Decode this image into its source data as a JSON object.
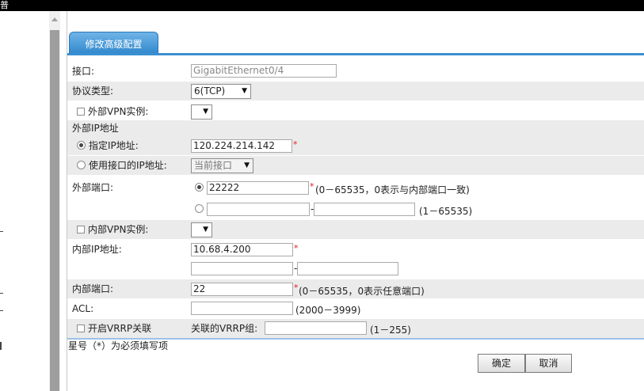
{
  "window": {
    "title_glyph": "普"
  },
  "tab": {
    "label": "修改高级配置"
  },
  "form": {
    "interface": {
      "label": "接口:",
      "value": "GigabitEthernet0/4"
    },
    "protocol": {
      "label": "协议类型:",
      "value": "6(TCP)"
    },
    "external_vpn": {
      "label": "外部VPN实例:",
      "checked": false,
      "value": ""
    },
    "external_ip_section": {
      "label": "外部IP地址"
    },
    "specified_ip": {
      "label": "指定IP地址:",
      "selected": true,
      "value": "120.224.214.142",
      "required": "*"
    },
    "use_interface_ip": {
      "label": "使用接口的IP地址:",
      "selected": false,
      "value": "当前接口"
    },
    "external_port": {
      "label": "外部端口:",
      "single": {
        "selected": true,
        "value": "22222",
        "required": "*",
        "hint": "(0－65535，0表示与内部端口一致)"
      },
      "range": {
        "selected": false,
        "from": "",
        "dash": "-",
        "to": "",
        "hint": "(1－65535)"
      }
    },
    "internal_vpn": {
      "label": "内部VPN实例:",
      "checked": false,
      "value": ""
    },
    "internal_ip": {
      "label": "内部IP地址:",
      "value": "10.68.4.200",
      "required": "*",
      "range_from": "",
      "dash": "-",
      "range_to": ""
    },
    "internal_port": {
      "label": "内部端口:",
      "value": "22",
      "required": "*",
      "hint": "(0－65535，0表示任意端口)"
    },
    "acl": {
      "label": "ACL:",
      "value": "",
      "hint": "(2000－3999)"
    },
    "vrrp": {
      "label": "开启VRRP关联",
      "checked": false,
      "group_label": "关联的VRRP组:",
      "group_value": "",
      "hint": "(1－255)"
    }
  },
  "note": "星号（*）为必须填写项",
  "buttons": {
    "ok": "确定",
    "cancel": "取消"
  },
  "icons": {
    "dropdown": "▼"
  },
  "colors": {
    "tab": "#2f87cc",
    "alt_row": "#ebebeb",
    "required": "#e02020"
  }
}
